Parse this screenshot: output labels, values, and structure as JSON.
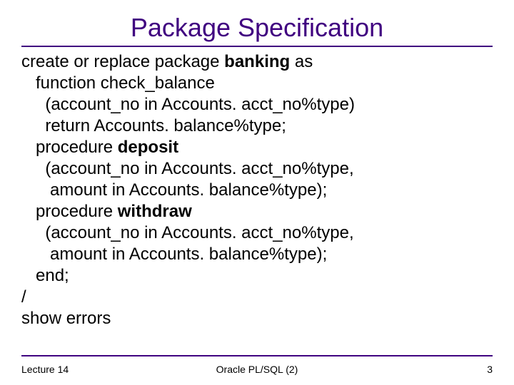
{
  "title": "Package Specification",
  "code": {
    "l1a": "create or replace package ",
    "l1b": "banking",
    "l1c": " as",
    "l2": "   function check_balance",
    "l3": "     (account_no in Accounts. acct_no%type)",
    "l4": "     return Accounts. balance%type;",
    "l5a": "   procedure ",
    "l5b": "deposit",
    "l6": "     (account_no in Accounts. acct_no%type,",
    "l7": "      amount in Accounts. balance%type);",
    "l8a": "   procedure ",
    "l8b": "withdraw",
    "l9": "     (account_no in Accounts. acct_no%type,",
    "l10": "      amount in Accounts. balance%type);",
    "l11": "   end;",
    "l12": "/",
    "l13": "show errors"
  },
  "footer": {
    "left": "Lecture 14",
    "center": "Oracle PL/SQL (2)",
    "right": "3"
  }
}
